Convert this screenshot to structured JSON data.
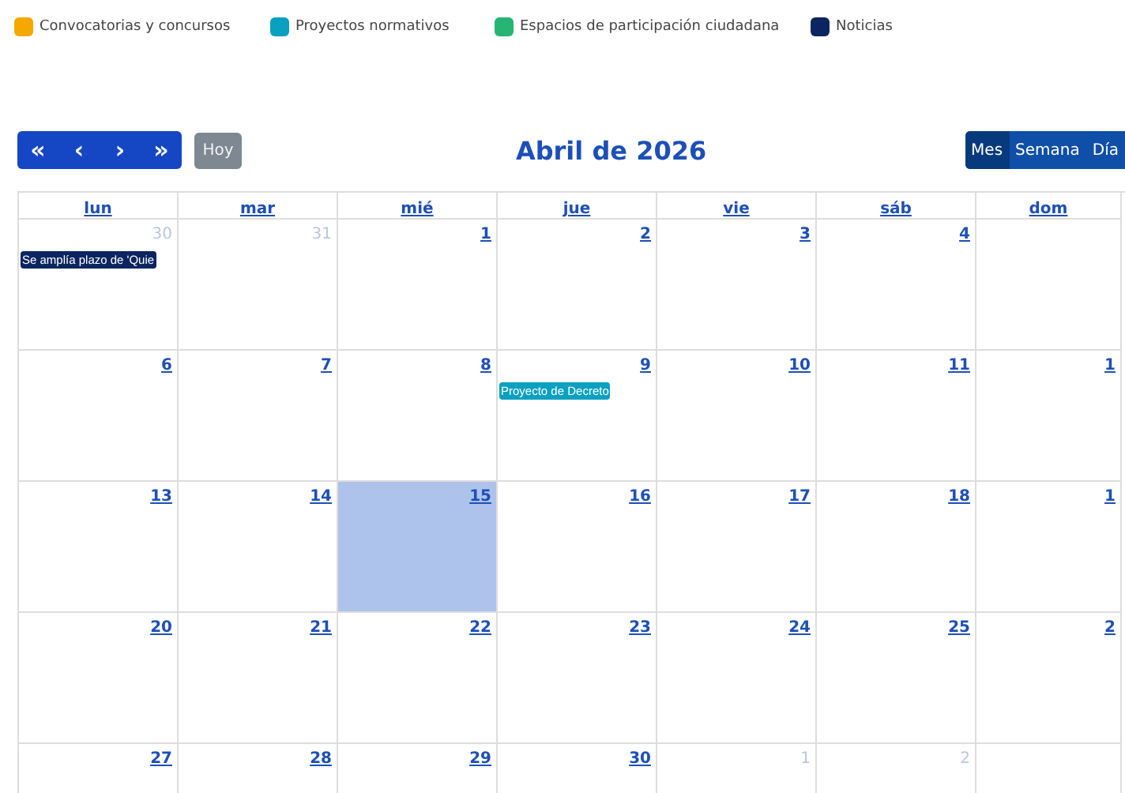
{
  "legend": [
    {
      "label": "Convocatorias y concursos",
      "color": "#f5a800"
    },
    {
      "label": "Proyectos normativos",
      "color": "#0aa0bf"
    },
    {
      "label": "Espacios de participación ciudadana",
      "color": "#26b573"
    },
    {
      "label": "Noticias",
      "color": "#0b2560"
    }
  ],
  "toolbar": {
    "nav": [
      "«",
      "‹",
      "›",
      "»"
    ],
    "today_button": {
      "label": "Hoy",
      "disabled": true
    },
    "title": "Abril de 2026",
    "views": [
      {
        "label": "Mes",
        "selected": true
      },
      {
        "label": "Semana",
        "selected": false
      },
      {
        "label": "Día",
        "selected": false
      }
    ]
  },
  "calendar": {
    "weekdays": [
      "lun",
      "mar",
      "mié",
      "jue",
      "vie",
      "sáb",
      "dom"
    ],
    "weeks": [
      [
        {
          "day": "30",
          "other_month": true,
          "selected": false,
          "events": [
            {
              "title": "Se amplía plazo de 'Quie",
              "color": "#0b2560"
            }
          ]
        },
        {
          "day": "31",
          "other_month": true,
          "selected": false
        },
        {
          "day": "1",
          "other_month": false,
          "selected": false
        },
        {
          "day": "2",
          "other_month": false,
          "selected": false
        },
        {
          "day": "3",
          "other_month": false,
          "selected": false
        },
        {
          "day": "4",
          "other_month": false,
          "selected": false
        }
      ],
      [
        {
          "day": "6",
          "other_month": false,
          "selected": false
        },
        {
          "day": "7",
          "other_month": false,
          "selected": false
        },
        {
          "day": "8",
          "other_month": false,
          "selected": false
        },
        {
          "day": "9",
          "other_month": false,
          "selected": false,
          "events": [
            {
              "title": "Proyecto de Decreto",
              "color": "#0aa0bf"
            }
          ]
        },
        {
          "day": "10",
          "other_month": false,
          "selected": false
        },
        {
          "day": "11",
          "other_month": false,
          "selected": false
        },
        {
          "day": "1",
          "other_month": false,
          "selected": false
        }
      ],
      [
        {
          "day": "13",
          "other_month": false,
          "selected": false
        },
        {
          "day": "14",
          "other_month": false,
          "selected": false
        },
        {
          "day": "15",
          "other_month": false,
          "selected": true
        },
        {
          "day": "16",
          "other_month": false,
          "selected": false
        },
        {
          "day": "17",
          "other_month": false,
          "selected": false
        },
        {
          "day": "18",
          "other_month": false,
          "selected": false
        },
        {
          "day": "1",
          "other_month": false,
          "selected": false
        }
      ],
      [
        {
          "day": "20",
          "other_month": false,
          "selected": false
        },
        {
          "day": "21",
          "other_month": false,
          "selected": false
        },
        {
          "day": "22",
          "other_month": false,
          "selected": false
        },
        {
          "day": "23",
          "other_month": false,
          "selected": false
        },
        {
          "day": "24",
          "other_month": false,
          "selected": false
        },
        {
          "day": "25",
          "other_month": false,
          "selected": false
        },
        {
          "day": "2",
          "other_month": false,
          "selected": false
        }
      ],
      [
        {
          "day": "27",
          "other_month": false,
          "selected": false
        },
        {
          "day": "28",
          "other_month": false,
          "selected": false
        },
        {
          "day": "29",
          "other_month": false,
          "selected": false
        },
        {
          "day": "30",
          "other_month": false,
          "selected": false
        },
        {
          "day": "1",
          "other_month": true,
          "selected": false
        },
        {
          "day": "2",
          "other_month": true,
          "selected": false
        }
      ]
    ]
  }
}
